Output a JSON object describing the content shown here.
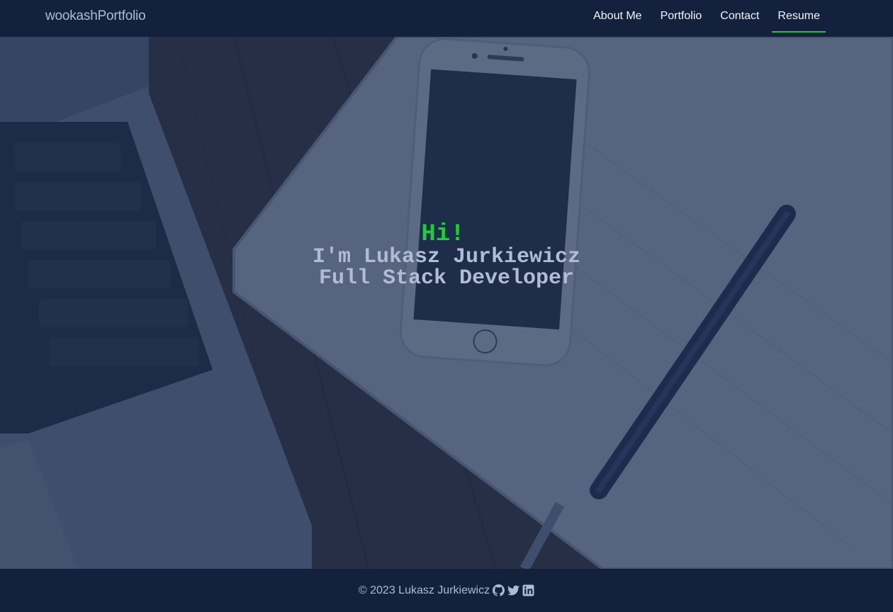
{
  "navbar": {
    "brand": "wookashPortfolio",
    "links": [
      {
        "label": "About Me"
      },
      {
        "label": "Portfolio"
      },
      {
        "label": "Contact"
      },
      {
        "label": "Resume",
        "active": true
      }
    ]
  },
  "hero": {
    "greeting": "Hi!",
    "name_line": "I'm Lukasz Jurkiewicz",
    "role_line": "Full Stack Developer",
    "background_image": "desk-with-laptop-phone-notebook-pen"
  },
  "footer": {
    "copyright": "© 2023 Lukasz Jurkiewicz",
    "icons": [
      "github-icon",
      "twitter-icon",
      "linkedin-icon"
    ]
  },
  "colors": {
    "nav_bg": "#13213d",
    "accent": "#1fcc3c",
    "hero_text": "#b2bcd3",
    "brand_text": "#aebbd8"
  }
}
